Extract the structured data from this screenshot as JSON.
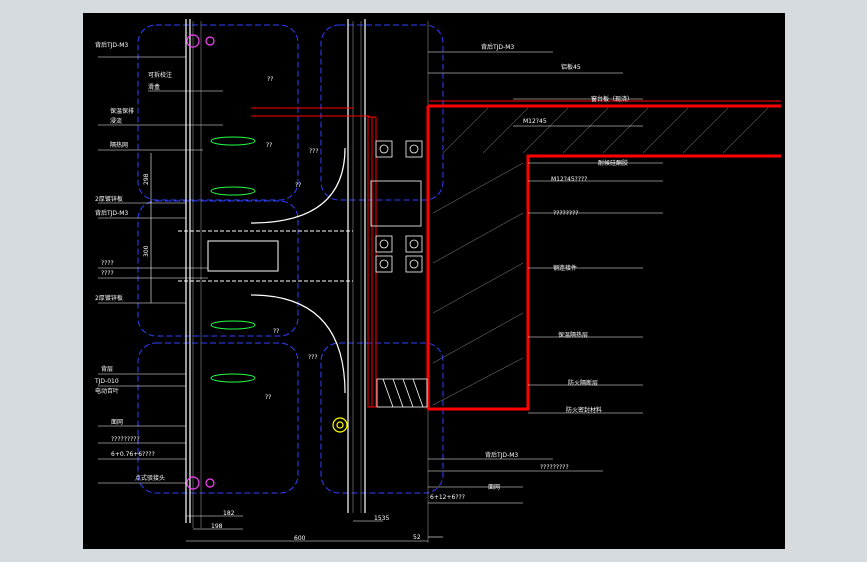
{
  "colors": {
    "background": "#000000",
    "frame": "#d6dbe0",
    "red": "#ff0000",
    "white": "#ffffff",
    "blue": "#3040ff",
    "cyan": "#00e0ff",
    "green": "#22ff44",
    "magenta": "#ff40ff",
    "yellow": "#ffff00",
    "gray": "#8a8a8a"
  },
  "labels_left": [
    "背后TJD-M3",
    "可拆校注",
    "滑盒",
    "保温保排",
    "浸流",
    "隔热网",
    "2厚镀锌板",
    "背后TJD-M3",
    "????",
    "????",
    "2厚镀锌板",
    "背层",
    "TJD-010",
    "电动百叶",
    "面网",
    "?????????",
    "6+0.76+6????",
    "点式驳接头"
  ],
  "labels_right": [
    "背后TJD-M3",
    "铝板45",
    "窗台板（现浇）",
    "M12?45",
    "耐候硅酮胶",
    "M12?45????",
    "????????",
    "钢连接件",
    "保温隔热层",
    "防火隔断层",
    "防火密封材料",
    "背后TJD-M3",
    "?????????",
    "6+12+6???",
    "面网"
  ],
  "dims_bottom": [
    "182",
    "198",
    "600",
    "1535",
    "52"
  ],
  "dims_left": [
    "298",
    "300"
  ],
  "glyphs": [
    "??",
    "???"
  ]
}
